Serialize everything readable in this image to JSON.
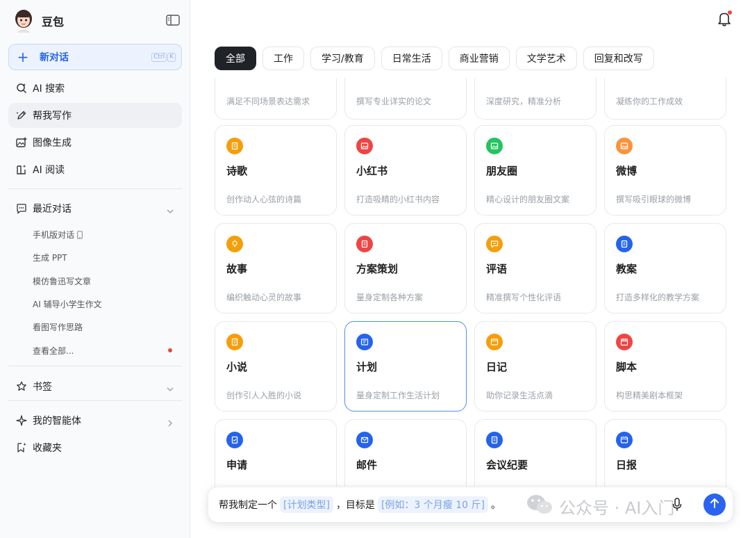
{
  "app": {
    "name": "豆包"
  },
  "sidebar": {
    "new_chat": {
      "label": "新对话",
      "shortcut": [
        "Ctrl",
        "K"
      ]
    },
    "nav": [
      {
        "label": "AI 搜索",
        "icon": "search-sparkle-icon"
      },
      {
        "label": "帮我写作",
        "icon": "pen-icon",
        "active": true
      },
      {
        "label": "图像生成",
        "icon": "image-plus-icon"
      },
      {
        "label": "AI 阅读",
        "icon": "book-sparkle-icon"
      }
    ],
    "recent": {
      "label": "最近对话",
      "items": [
        "手机版对话",
        "生成 PPT",
        "模仿鲁迅写文章",
        "AI 辅导小学生作文",
        "看图写作思路",
        "查看全部..."
      ]
    },
    "bookmarks": {
      "label": "书签"
    },
    "agents": {
      "label": "我的智能体"
    },
    "favorites": {
      "label": "收藏夹"
    }
  },
  "tabs": [
    "全部",
    "工作",
    "学习/教育",
    "日常生活",
    "商业营销",
    "文学艺术",
    "回复和改写"
  ],
  "active_tab": "全部",
  "cards_partial": [
    "满足不同场景表达需求",
    "撰写专业详实的论文",
    "深度研究，精准分析",
    "凝练你的工作成效"
  ],
  "cards": [
    {
      "title": "诗歌",
      "desc": "创作动人心弦的诗篇",
      "color": "#f59e0b",
      "icon": "poem-icon"
    },
    {
      "title": "小红书",
      "desc": "打造吸睛的小红书内容",
      "color": "#ef4444",
      "icon": "xiaohongshu-icon"
    },
    {
      "title": "朋友圈",
      "desc": "精心设计的朋友圈文案",
      "color": "#22c55e",
      "icon": "moments-icon"
    },
    {
      "title": "微博",
      "desc": "撰写吸引眼球的微博",
      "color": "#fb923c",
      "icon": "weibo-icon"
    },
    {
      "title": "故事",
      "desc": "编织触动心灵的故事",
      "color": "#f59e0b",
      "icon": "lightbulb-icon"
    },
    {
      "title": "方案策划",
      "desc": "量身定制各种方案",
      "color": "#ef4444",
      "icon": "plan-doc-icon"
    },
    {
      "title": "评语",
      "desc": "精准撰写个性化评语",
      "color": "#f59e0b",
      "icon": "comment-icon"
    },
    {
      "title": "教案",
      "desc": "打造多样化的教学方案",
      "color": "#2563eb",
      "icon": "lesson-doc-icon"
    },
    {
      "title": "小说",
      "desc": "创作引人入胜的小说",
      "color": "#f59e0b",
      "icon": "novel-icon"
    },
    {
      "title": "计划",
      "desc": "量身定制工作生活计划",
      "color": "#2563eb",
      "icon": "plan-list-icon",
      "selected": true
    },
    {
      "title": "日记",
      "desc": "助你记录生活点滴",
      "color": "#f59e0b",
      "icon": "diary-icon"
    },
    {
      "title": "脚本",
      "desc": "构思精美剧本框架",
      "color": "#ef4444",
      "icon": "clapper-icon"
    },
    {
      "title": "申请",
      "desc": "",
      "color": "#2563eb",
      "icon": "application-icon"
    },
    {
      "title": "邮件",
      "desc": "",
      "color": "#2563eb",
      "icon": "mail-icon"
    },
    {
      "title": "会议纪要",
      "desc": "",
      "color": "#2563eb",
      "icon": "minutes-icon"
    },
    {
      "title": "日报",
      "desc": "",
      "color": "#2563eb",
      "icon": "daily-report-icon"
    }
  ],
  "composer": {
    "prefix": "帮我制定一个",
    "slot1": "[计划类型]",
    "middle": "，目标是",
    "slot2": "[例如：3 个月瘦 10 斤]",
    "suffix": "。"
  },
  "watermark": "公众号 · AI入门"
}
